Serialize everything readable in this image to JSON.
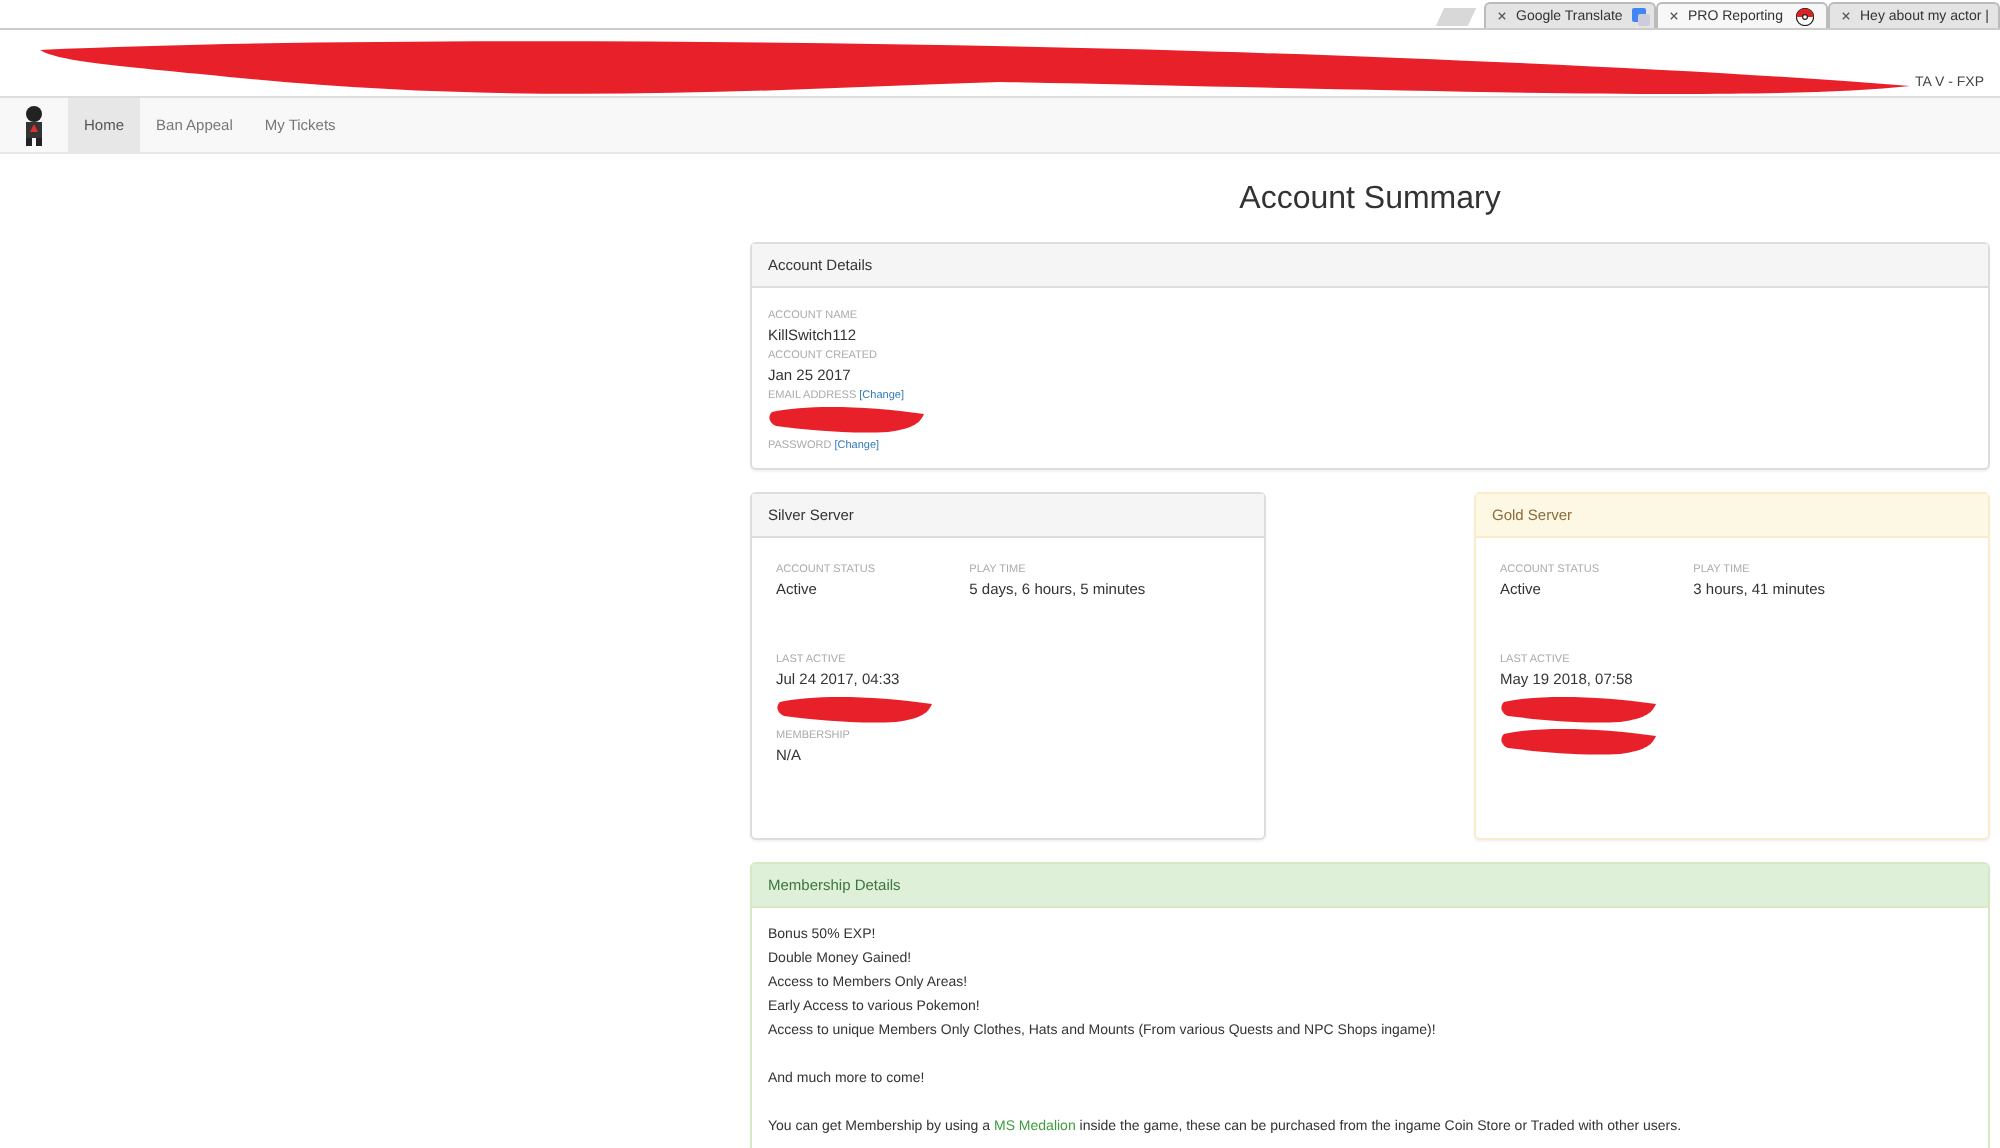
{
  "browser_tabs": [
    {
      "title": "Google Translate",
      "selected": false,
      "kind": "translate"
    },
    {
      "title": "PRO Reporting",
      "selected": true,
      "kind": "ball"
    },
    {
      "title": "Hey about my actor |",
      "selected": false,
      "kind": "plain"
    }
  ],
  "bookmark_bar": {
    "item": "TA V - FXP"
  },
  "nav": {
    "items": [
      {
        "label": "Home",
        "selected": true
      },
      {
        "label": "Ban Appeal",
        "selected": false
      },
      {
        "label": "My Tickets",
        "selected": false
      }
    ]
  },
  "page_title": "Account Summary",
  "account_details": {
    "title": "Account Details",
    "fields": [
      {
        "kind": "field",
        "label": "ACCOUNT NAME",
        "value": "KillSwitch112"
      },
      {
        "kind": "field",
        "label": "ACCOUNT CREATED",
        "value": "Jan 25 2017"
      },
      {
        "kind": "field",
        "label": "EMAIL ADDRESS",
        "link": "[Change]"
      },
      {
        "kind": "redacted"
      },
      {
        "kind": "field",
        "label": "PASSWORD",
        "link": "[Change]"
      }
    ]
  },
  "servers": [
    {
      "title": "Silver Server",
      "kind": "silver",
      "stats": [
        {
          "label": "ACCOUNT STATUS",
          "value": "Active"
        },
        {
          "label": "PLAY TIME",
          "value": "5 days, 6 hours, 5 minutes"
        }
      ],
      "fields": [
        {
          "kind": "field",
          "label": "LAST ACTIVE",
          "value": "Jul 24 2017, 04:33"
        },
        {
          "kind": "redacted"
        },
        {
          "kind": "field",
          "label": "MEMBERSHIP",
          "value": "N/A"
        }
      ]
    },
    {
      "title": "Gold Server",
      "kind": "gold",
      "stats": [
        {
          "label": "ACCOUNT STATUS",
          "value": "Active"
        },
        {
          "label": "PLAY TIME",
          "value": "3 hours, 41 minutes"
        }
      ],
      "fields": [
        {
          "kind": "field",
          "label": "LAST ACTIVE",
          "value": "May 19 2018, 07:58"
        },
        {
          "kind": "redacted"
        },
        {
          "kind": "redacted"
        }
      ]
    }
  ],
  "membership": {
    "title": "Membership Details",
    "perks": [
      "Bonus 50% EXP!",
      "Double Money Gained!",
      "Access to Members Only Areas!",
      "Early Access to various Pokemon!",
      "Access to unique Members Only Clothes, Hats and Mounts (From various Quests and NPC Shops ingame)!"
    ],
    "closing": "And much more to come!",
    "note_before": "You can get Membership by using a",
    "note_link": "MS Medalion",
    "note_after": "inside the game, these can be purchased from the ingame Coin Store or Traded with other users."
  }
}
